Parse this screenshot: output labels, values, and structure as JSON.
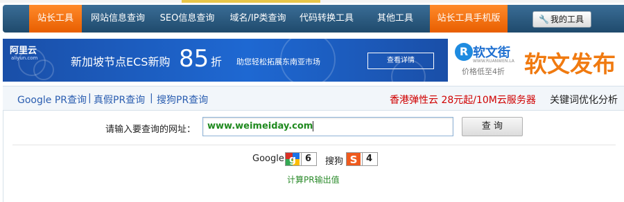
{
  "nav": {
    "items": [
      "站长工具",
      "网站信息查询",
      "SEO信息查询",
      "域名/IP类查询",
      "代码转换工具",
      "其他工具",
      "站长工具手机版"
    ],
    "my_tools": "我的工具"
  },
  "ad_left": {
    "brand": "阿里云",
    "brand_sub": "aliyun.com",
    "promo_text": "新加坡节点ECS新购",
    "promo_number": "85",
    "promo_suffix": "折",
    "description": "助您轻松拓展东南亚市场",
    "detail_button": "查看详情"
  },
  "ad_right": {
    "logo_letter": "R",
    "brand": "软文街",
    "url": "WWW.RUANWEN.LA",
    "slogan": "价格低至4折",
    "headline": "软文发布"
  },
  "links": {
    "items": [
      "Google PR查询",
      "真假PR查询",
      "搜狗PR查询"
    ],
    "separator": "|",
    "promo": "香港弹性云 28元起/10M云服务器",
    "keyword": "关键词优化分析"
  },
  "query": {
    "label": "请输入要查询的网址：",
    "value": "www.weimeiday.com",
    "button": "查 询"
  },
  "results": {
    "google_label": "Google",
    "google_pr": "6",
    "sogou_label": "搜狗",
    "sogou_pr": "4",
    "calc_text": "计算PR输出值"
  },
  "colors": {
    "nav_bg": "#2a5a80",
    "nav_active": "#f07010",
    "link_blue": "#2a5db0",
    "promo_red": "#d00000",
    "value_green": "#1f8a1f"
  }
}
